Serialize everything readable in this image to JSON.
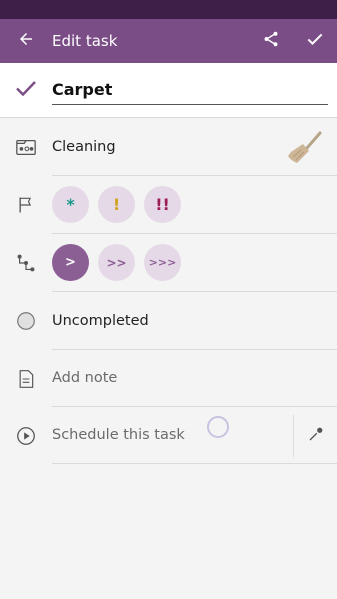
{
  "appbar": {
    "title": "Edit task",
    "back_icon": "arrow-back-icon",
    "share_icon": "share-icon",
    "save_icon": "check-icon"
  },
  "task": {
    "name": "Carpet"
  },
  "folder": {
    "label": "Cleaning",
    "icon": "broom-icon"
  },
  "priority": {
    "options": [
      "*",
      "!",
      "!!"
    ],
    "colors": [
      "#1b9a8a",
      "#d1a21e",
      "#9a1f55"
    ]
  },
  "urgency": {
    "options": [
      ">",
      ">>",
      ">>>"
    ],
    "selected_index": 0,
    "accent": "#8b5e94"
  },
  "status": {
    "label": "Uncompleted"
  },
  "note": {
    "placeholder": "Add note"
  },
  "schedule": {
    "placeholder": "Schedule this task"
  },
  "colors": {
    "primary": "#7a4d87",
    "statusbar": "#3d1f47",
    "chip_bg": "#e6d9e7"
  }
}
